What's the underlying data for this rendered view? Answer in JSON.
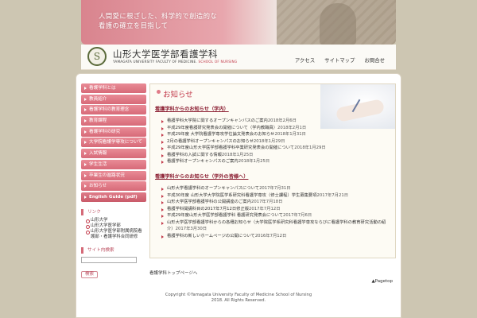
{
  "header": {
    "tagline_line1": "人間愛に根ざした、科学的で創造的な",
    "tagline_line2": "看護の確立を目指して",
    "brand_jp": "山形大学医学部看護学科",
    "brand_en_main": "YAMAGATA UNIVERSITY FACULTY OF MEDICINE.",
    "brand_en_sub": "SCHOOL OF NURSING",
    "logo_glyph": "S",
    "nav": [
      "アクセス",
      "サイトマップ",
      "お問合せ"
    ]
  },
  "sidebar": {
    "menu": [
      "看護学科とは",
      "教員紹介",
      "看護学科の教育理念",
      "教育課程",
      "看護学科の研究",
      "大学院看護学専攻について",
      "入試情報",
      "学生生活",
      "卒業生の進路状況",
      "お知らせ",
      "English Guide (pdf)"
    ],
    "links_title": "リンク",
    "links": [
      "山形大学",
      "山形大学医学部",
      "山形大学医学部附属病院看護部・看護学科合同研修"
    ],
    "search_title": "サイト内検索",
    "search_button": "検索"
  },
  "main": {
    "page_title": "お知らせ",
    "section1_title": "看護学科からのお知らせ（学内）",
    "section1": [
      {
        "text": "看護学科大学院に関するオープンキャンパスのご案内",
        "date": "2018年2月6日"
      },
      {
        "text": "平成29年度看護研究発表会の開催について（学内教職員）",
        "date": "2018年2月1日"
      },
      {
        "text": "平成29年度 大学院看護学専攻学位論文発表会のお知らせ",
        "date": "2018年1月31日"
      },
      {
        "text": "2月の看護学科オープンキャンパスのお知らせ",
        "date": "2018年1月29日"
      },
      {
        "text": "平成29年度山形大学医学部看護学科卒業研究発表会の開催について",
        "date": "2018年1月29日"
      },
      {
        "text": "看護学科の入試に関する情報",
        "date": "2018年1月25日"
      },
      {
        "text": "看護学科オープンキャンパスのご案内",
        "date": "2018年1月25日"
      }
    ],
    "section2_title": "看護学科からのお知らせ（学外の皆様へ）",
    "section2": [
      {
        "text": "山形大学看護学科のオープンキャンパスについて",
        "date": "2017年7月31日"
      },
      {
        "text": "平成30年度 山形大学大学院医学系研究科看護学専攻（修士課程）学生募集要項",
        "date": "2017年7月21日"
      },
      {
        "text": "山形大学医学部看護学科の公開講座のご案内",
        "date": "2017年7月18日"
      },
      {
        "text": "看護学科開講科目の2017年7月12日修正版",
        "date": "2017年7月12日"
      },
      {
        "text": "平成29年度山形大学医学部看護学科 看護研究発表会について",
        "date": "2017年7月6日"
      },
      {
        "text": "山形大学医学部看護学科からの各種お知らせ（大学院医学系研究科看護学専攻ならびに看護学科の教育研究活動の紹介）",
        "date": "2017年3月30日"
      },
      {
        "text": "看護学科の新しいホームページの公開について",
        "date": "2016年7月12日"
      }
    ],
    "bottom_link": "看護学科トップページへ",
    "pagetop": "▲Pagetop"
  },
  "footer": {
    "copyright": "Copyright ©Yamagata University Faculty of Medicine School of Nursing",
    "rights": "2018. All Rights Reserved."
  }
}
